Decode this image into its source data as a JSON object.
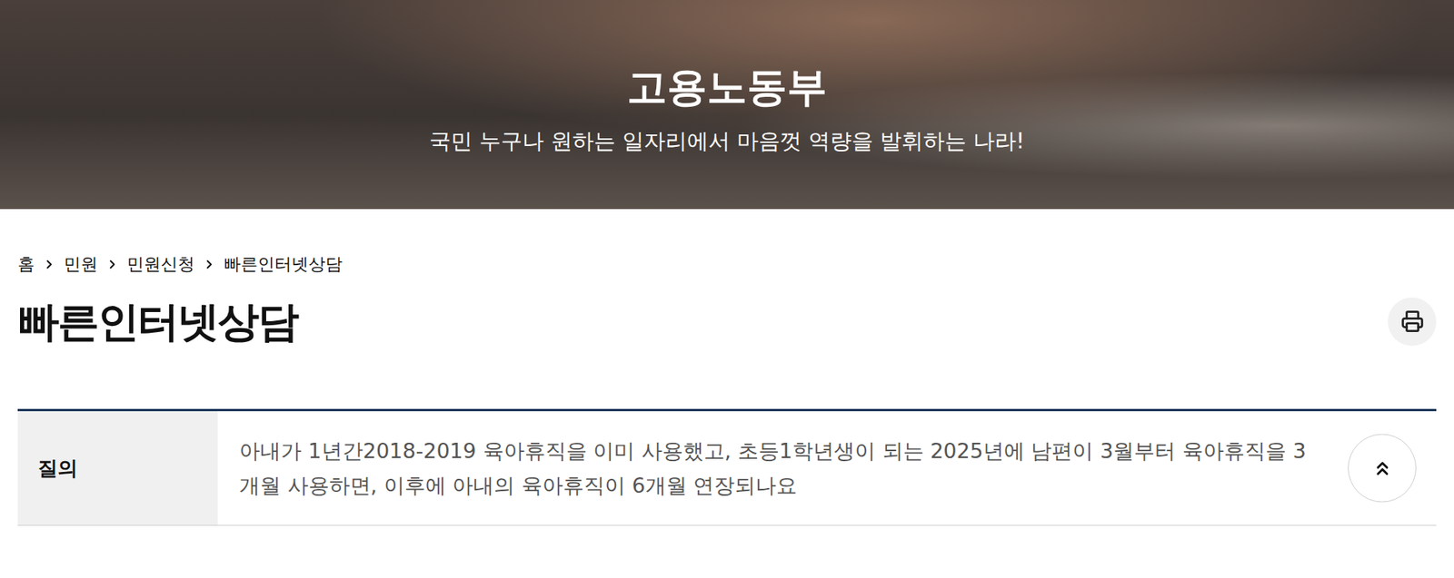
{
  "header": {
    "title": "고용노동부",
    "slogan": "국민 누구나 원하는 일자리에서 마음껏 역량을 발휘하는 나라!"
  },
  "breadcrumb": [
    "홈",
    "민원",
    "민원신청",
    "빠른인터넷상담"
  ],
  "page": {
    "title": "빠른인터넷상담"
  },
  "rows": [
    {
      "label": "질의",
      "text": "아내가 1년간2018-2019 육아휴직을 이미 사용했고, 초등1학년생이 되는 2025년에 남편이 3월부터 육아휴직을 3개월 사용하면, 이후에 아내의 육아휴직이 6개월 연장되나요"
    }
  ]
}
